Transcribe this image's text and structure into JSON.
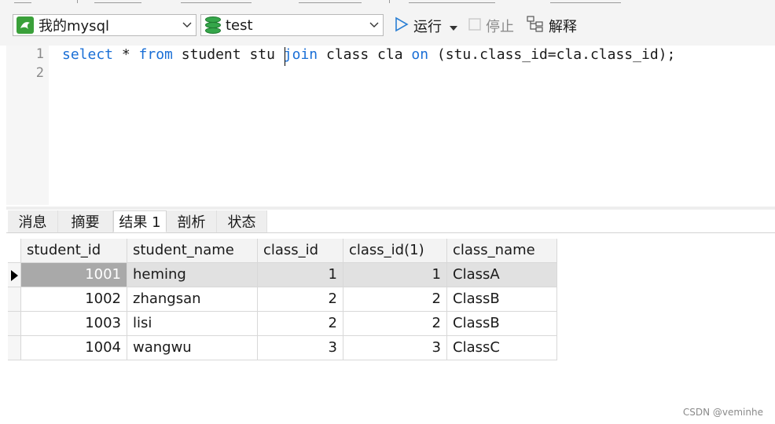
{
  "toolbar": {
    "connection": "我的mysql",
    "database": "test",
    "run_label": "运行",
    "stop_label": "停止",
    "explain_label": "解释"
  },
  "editor": {
    "line_numbers": [
      "1",
      "2"
    ],
    "code_tokens": [
      {
        "t": "select",
        "kw": true
      },
      {
        "t": " * ",
        "kw": false
      },
      {
        "t": "from",
        "kw": true
      },
      {
        "t": " student stu ",
        "kw": false
      },
      {
        "t": "join",
        "kw": true
      },
      {
        "t": " class cla ",
        "kw": false
      },
      {
        "t": "on",
        "kw": true
      },
      {
        "t": " (stu.class_id=cla.class_id);",
        "kw": false
      }
    ]
  },
  "tabs": [
    "消息",
    "摘要",
    "结果 1",
    "剖析",
    "状态"
  ],
  "active_tab": "结果 1",
  "table": {
    "columns": [
      "student_id",
      "student_name",
      "class_id",
      "class_id(1)",
      "class_name"
    ],
    "rows": [
      [
        "1001",
        "heming",
        "1",
        "1",
        "ClassA"
      ],
      [
        "1002",
        "zhangsan",
        "2",
        "2",
        "ClassB"
      ],
      [
        "1003",
        "lisi",
        "2",
        "2",
        "ClassB"
      ],
      [
        "1004",
        "wangwu",
        "3",
        "3",
        "ClassC"
      ]
    ],
    "selected_row": 0
  },
  "watermark": "CSDN @veminhe",
  "colors": {
    "keyword": "#1a6fd6",
    "selected_cell": "#a9a9a9",
    "connection_icon": "#3aa03a",
    "db_icon": "#35a64a"
  }
}
